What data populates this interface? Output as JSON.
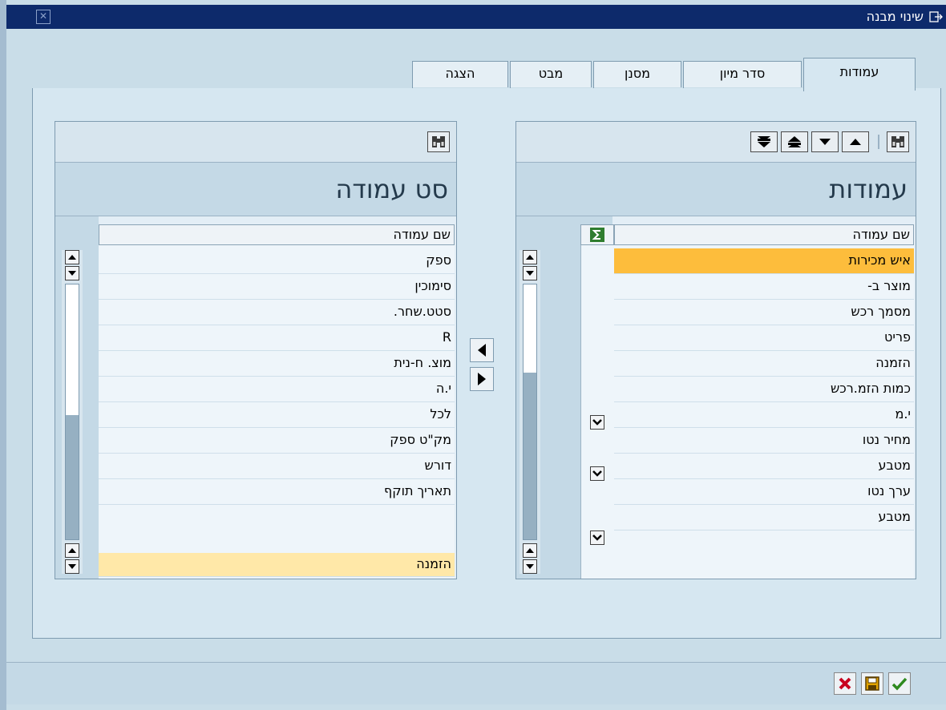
{
  "window": {
    "title": "שינוי מבנה"
  },
  "tabs": [
    {
      "label": "עמודות",
      "active": true
    },
    {
      "label": "סדר מיון",
      "active": false
    },
    {
      "label": "מסנן",
      "active": false
    },
    {
      "label": "מבט",
      "active": false
    },
    {
      "label": "הצגה",
      "active": false
    }
  ],
  "columns_panel": {
    "heading": "עמודות",
    "column_header": "שם עמודה",
    "rows": [
      {
        "label": "איש מכירות",
        "selected": true,
        "has_dropdown": false
      },
      {
        "label": "מוצר ב-",
        "selected": false,
        "has_dropdown": false
      },
      {
        "label": "מסמך רכש",
        "selected": false,
        "has_dropdown": false
      },
      {
        "label": "פריט",
        "selected": false,
        "has_dropdown": false
      },
      {
        "label": "הזמנה",
        "selected": false,
        "has_dropdown": false
      },
      {
        "label": "כמות הזמ.רכש",
        "selected": false,
        "has_dropdown": true
      },
      {
        "label": "י.מ",
        "selected": false,
        "has_dropdown": false
      },
      {
        "label": "מחיר נטו",
        "selected": false,
        "has_dropdown": true
      },
      {
        "label": "מטבע",
        "selected": false,
        "has_dropdown": false
      },
      {
        "label": "ערך נטו",
        "selected": false,
        "has_dropdown": true
      },
      {
        "label": "מטבע",
        "selected": false,
        "has_dropdown": false
      }
    ]
  },
  "column_set_panel": {
    "heading": "סט עמודה",
    "column_header": "שם עמודה",
    "rows": [
      {
        "label": "ספק",
        "selected": false
      },
      {
        "label": "סימוכין",
        "selected": false
      },
      {
        "label": "סטט.שחר.",
        "selected": false
      },
      {
        "label": "R",
        "selected": false
      },
      {
        "label": "מוצ. ח-נית",
        "selected": false
      },
      {
        "label": "י.ה",
        "selected": false
      },
      {
        "label": "לכל",
        "selected": false
      },
      {
        "label": "מק\"ט ספק",
        "selected": false
      },
      {
        "label": "דורש",
        "selected": false
      },
      {
        "label": "תאריך תוקף",
        "selected": false
      },
      {
        "label": "הזמנה",
        "selected": true
      }
    ]
  },
  "colors": {
    "title_bar": "#0d2a6b",
    "row_selected": "#fdbd3c",
    "row_selected_light": "#ffe8a8",
    "background": "#c9dde8"
  }
}
